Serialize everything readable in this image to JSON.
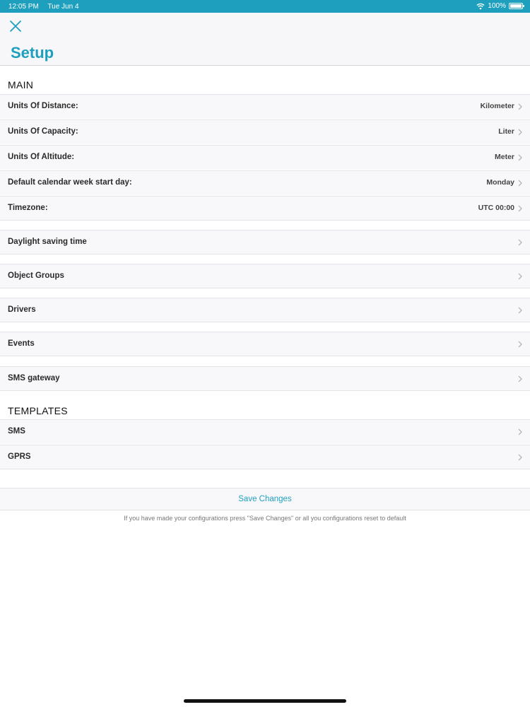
{
  "status_bar": {
    "time": "12:05 PM",
    "date": "Tue Jun 4",
    "battery": "100%"
  },
  "header": {
    "title": "Setup"
  },
  "sections": {
    "main": {
      "title": "MAIN",
      "rows": [
        {
          "label": "Units Of Distance:",
          "value": "Kilometer"
        },
        {
          "label": "Units Of Capacity:",
          "value": "Liter"
        },
        {
          "label": "Units Of Altitude:",
          "value": "Meter"
        },
        {
          "label": "Default calendar week start day:",
          "value": "Monday"
        },
        {
          "label": "Timezone:",
          "value": "UTC 00:00"
        }
      ]
    },
    "nav": [
      {
        "label": "Daylight saving time"
      },
      {
        "label": "Object Groups"
      },
      {
        "label": "Drivers"
      },
      {
        "label": "Events"
      },
      {
        "label": "SMS gateway"
      }
    ],
    "templates": {
      "title": "TEMPLATES",
      "rows": [
        {
          "label": "SMS"
        },
        {
          "label": "GPRS"
        }
      ]
    }
  },
  "save": {
    "label": "Save Changes",
    "hint": "If you have made your configurations press \"Save Changes\" or all you configurations reset to default"
  },
  "colors": {
    "accent": "#1e9fbd",
    "status_bar": "#1e9fbd"
  }
}
